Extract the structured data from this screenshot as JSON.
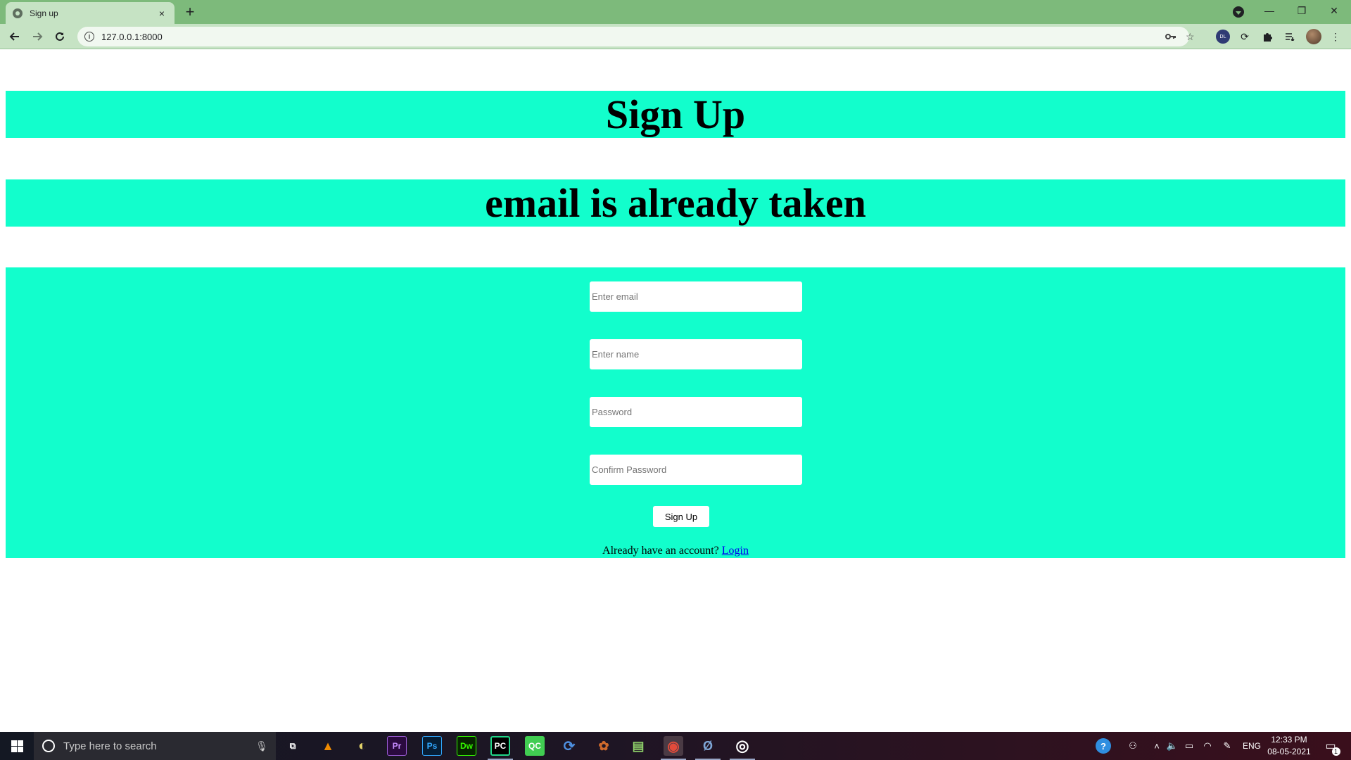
{
  "browser": {
    "tab_title": "Sign up",
    "tab_close": "×",
    "new_tab": "+",
    "url": "127.0.0.1:8000",
    "window_controls": {
      "minimize": "—",
      "restore": "❐",
      "close": "✕"
    },
    "toolbar_icons": [
      "key-icon",
      "star-icon",
      "extension-dualless-icon",
      "sync-icon",
      "puzzle-icon",
      "reading-list-icon",
      "profile-avatar",
      "more-menu-icon"
    ]
  },
  "page": {
    "heading": "Sign Up",
    "error_message": "email is already taken",
    "form": {
      "email_placeholder": "Enter email",
      "name_placeholder": "Enter name",
      "password_placeholder": "Password",
      "confirm_placeholder": "Confirm Password",
      "submit_label": "Sign Up",
      "login_prompt": "Already have an account? ",
      "login_link": "Login"
    },
    "accent_color": "#12fecc"
  },
  "taskbar": {
    "search_placeholder": "Type here to search",
    "apps": [
      {
        "name": "task-view",
        "label": "⧉"
      },
      {
        "name": "vlc",
        "label": "▲"
      },
      {
        "name": "app-circle",
        "label": "◐"
      },
      {
        "name": "premiere",
        "label": "Pr"
      },
      {
        "name": "photoshop",
        "label": "Ps"
      },
      {
        "name": "dreamweaver",
        "label": "Dw"
      },
      {
        "name": "pycharm",
        "label": "PC"
      },
      {
        "name": "qt-creator",
        "label": "QC"
      },
      {
        "name": "app-sync",
        "label": "⟳"
      },
      {
        "name": "app-squirrel",
        "label": "✿"
      },
      {
        "name": "notepad-pp",
        "label": "▤"
      },
      {
        "name": "chrome",
        "label": "◉"
      },
      {
        "name": "postgres",
        "label": "Ø"
      },
      {
        "name": "app-target",
        "label": "◎"
      }
    ],
    "language": "ENG",
    "time": "12:33 PM",
    "date": "08-05-2021",
    "notification_count": "1"
  }
}
